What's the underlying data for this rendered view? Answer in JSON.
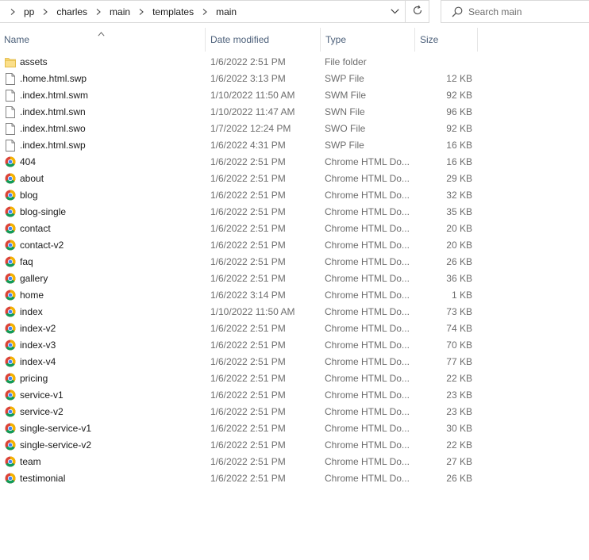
{
  "breadcrumb": [
    "pp",
    "charles",
    "main",
    "templates",
    "main"
  ],
  "search": {
    "placeholder": "Search main"
  },
  "columns": {
    "name": "Name",
    "date": "Date modified",
    "type": "Type",
    "size": "Size"
  },
  "files": [
    {
      "name": "assets",
      "date": "1/6/2022 2:51 PM",
      "type": "File folder",
      "size": "",
      "icon": "folder-icon"
    },
    {
      "name": ".home.html.swp",
      "date": "1/6/2022 3:13 PM",
      "type": "SWP File",
      "size": "12 KB",
      "icon": "file-icon"
    },
    {
      "name": ".index.html.swm",
      "date": "1/10/2022 11:50 AM",
      "type": "SWM File",
      "size": "92 KB",
      "icon": "file-icon"
    },
    {
      "name": ".index.html.swn",
      "date": "1/10/2022 11:47 AM",
      "type": "SWN File",
      "size": "96 KB",
      "icon": "file-icon"
    },
    {
      "name": ".index.html.swo",
      "date": "1/7/2022 12:24 PM",
      "type": "SWO File",
      "size": "92 KB",
      "icon": "file-icon"
    },
    {
      "name": ".index.html.swp",
      "date": "1/6/2022 4:31 PM",
      "type": "SWP File",
      "size": "16 KB",
      "icon": "file-icon"
    },
    {
      "name": "404",
      "date": "1/6/2022 2:51 PM",
      "type": "Chrome HTML Do...",
      "size": "16 KB",
      "icon": "chrome-icon"
    },
    {
      "name": "about",
      "date": "1/6/2022 2:51 PM",
      "type": "Chrome HTML Do...",
      "size": "29 KB",
      "icon": "chrome-icon"
    },
    {
      "name": "blog",
      "date": "1/6/2022 2:51 PM",
      "type": "Chrome HTML Do...",
      "size": "32 KB",
      "icon": "chrome-icon"
    },
    {
      "name": "blog-single",
      "date": "1/6/2022 2:51 PM",
      "type": "Chrome HTML Do...",
      "size": "35 KB",
      "icon": "chrome-icon"
    },
    {
      "name": "contact",
      "date": "1/6/2022 2:51 PM",
      "type": "Chrome HTML Do...",
      "size": "20 KB",
      "icon": "chrome-icon"
    },
    {
      "name": "contact-v2",
      "date": "1/6/2022 2:51 PM",
      "type": "Chrome HTML Do...",
      "size": "20 KB",
      "icon": "chrome-icon"
    },
    {
      "name": "faq",
      "date": "1/6/2022 2:51 PM",
      "type": "Chrome HTML Do...",
      "size": "26 KB",
      "icon": "chrome-icon"
    },
    {
      "name": "gallery",
      "date": "1/6/2022 2:51 PM",
      "type": "Chrome HTML Do...",
      "size": "36 KB",
      "icon": "chrome-icon"
    },
    {
      "name": "home",
      "date": "1/6/2022 3:14 PM",
      "type": "Chrome HTML Do...",
      "size": "1 KB",
      "icon": "chrome-icon"
    },
    {
      "name": "index",
      "date": "1/10/2022 11:50 AM",
      "type": "Chrome HTML Do...",
      "size": "73 KB",
      "icon": "chrome-icon"
    },
    {
      "name": "index-v2",
      "date": "1/6/2022 2:51 PM",
      "type": "Chrome HTML Do...",
      "size": "74 KB",
      "icon": "chrome-icon"
    },
    {
      "name": "index-v3",
      "date": "1/6/2022 2:51 PM",
      "type": "Chrome HTML Do...",
      "size": "70 KB",
      "icon": "chrome-icon"
    },
    {
      "name": "index-v4",
      "date": "1/6/2022 2:51 PM",
      "type": "Chrome HTML Do...",
      "size": "77 KB",
      "icon": "chrome-icon"
    },
    {
      "name": "pricing",
      "date": "1/6/2022 2:51 PM",
      "type": "Chrome HTML Do...",
      "size": "22 KB",
      "icon": "chrome-icon"
    },
    {
      "name": "service-v1",
      "date": "1/6/2022 2:51 PM",
      "type": "Chrome HTML Do...",
      "size": "23 KB",
      "icon": "chrome-icon"
    },
    {
      "name": "service-v2",
      "date": "1/6/2022 2:51 PM",
      "type": "Chrome HTML Do...",
      "size": "23 KB",
      "icon": "chrome-icon"
    },
    {
      "name": "single-service-v1",
      "date": "1/6/2022 2:51 PM",
      "type": "Chrome HTML Do...",
      "size": "30 KB",
      "icon": "chrome-icon"
    },
    {
      "name": "single-service-v2",
      "date": "1/6/2022 2:51 PM",
      "type": "Chrome HTML Do...",
      "size": "22 KB",
      "icon": "chrome-icon"
    },
    {
      "name": "team",
      "date": "1/6/2022 2:51 PM",
      "type": "Chrome HTML Do...",
      "size": "27 KB",
      "icon": "chrome-icon"
    },
    {
      "name": "testimonial",
      "date": "1/6/2022 2:51 PM",
      "type": "Chrome HTML Do...",
      "size": "26 KB",
      "icon": "chrome-icon"
    }
  ],
  "colors": {
    "header_text": "#4c607a",
    "secondary_text": "#6d6d6d",
    "folder": "#f8d775",
    "border": "#d9d9d9"
  }
}
